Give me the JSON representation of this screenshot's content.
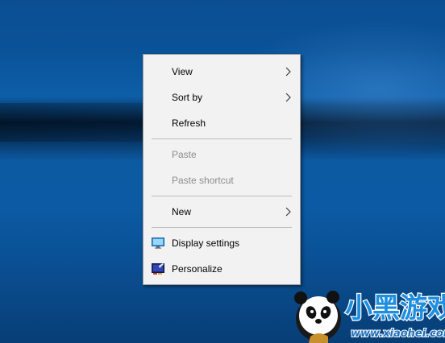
{
  "context_menu": {
    "items": [
      {
        "label": "View",
        "has_submenu": true,
        "enabled": true
      },
      {
        "label": "Sort by",
        "has_submenu": true,
        "enabled": true
      },
      {
        "label": "Refresh",
        "has_submenu": false,
        "enabled": true
      },
      {
        "label": "Paste",
        "has_submenu": false,
        "enabled": false
      },
      {
        "label": "Paste shortcut",
        "has_submenu": false,
        "enabled": false
      },
      {
        "label": "New",
        "has_submenu": true,
        "enabled": true
      },
      {
        "label": "Display settings",
        "icon": "display-settings-icon",
        "enabled": true
      },
      {
        "label": "Personalize",
        "icon": "personalize-icon",
        "enabled": true
      }
    ]
  },
  "watermark": {
    "title": "小黑游戏",
    "url": "www.xiaohei.com"
  },
  "colors": {
    "menu_background": "#f2f2f2",
    "disabled_text": "#8c8c8c",
    "desktop_blue": "#0a5298"
  }
}
